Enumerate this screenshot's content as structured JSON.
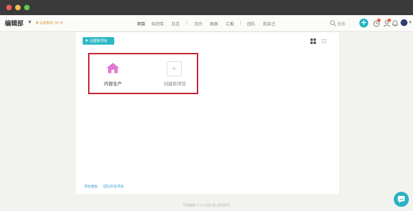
{
  "app": {
    "brand": "编辑部",
    "org_note": "▼ 试用剩余 30 天"
  },
  "nav": {
    "items": [
      "项目",
      "知识库",
      "日志",
      "日历",
      "图表",
      "汇报",
      "团队",
      "我自己"
    ]
  },
  "search": {
    "label": "搜索"
  },
  "toolbar": {
    "create_label": "创建新项目"
  },
  "projects": {
    "items": [
      {
        "name": "内容生产",
        "icon": "house-icon",
        "color": "#e07ad2"
      }
    ],
    "new_label": "创建新项目"
  },
  "footer": {
    "links": [
      "项目模板",
      "团队所有项目"
    ],
    "note": "内容编辑 1.0.0 (团队版) 版权所有"
  },
  "colors": {
    "accent": "#2eb8c6",
    "highlight": "#c8202d",
    "badge": "#e8604c"
  }
}
